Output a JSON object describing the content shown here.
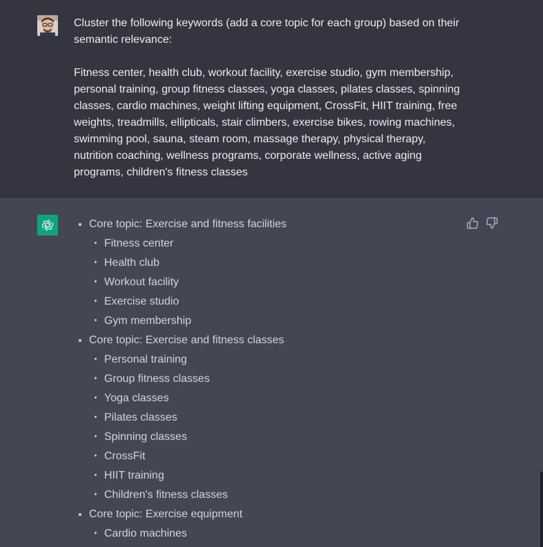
{
  "user_message": {
    "text": "Cluster the following keywords (add a core topic for each group) based on their semantic relevance:\n\nFitness center, health club, workout facility, exercise studio, gym membership, personal training, group fitness classes, yoga classes, pilates classes, spinning classes, cardio machines, weight lifting equipment, CrossFit, HIIT training, free weights, treadmills, ellipticals, stair climbers, exercise bikes, rowing machines, swimming pool, sauna, steam room, massage therapy, physical therapy, nutrition coaching, wellness programs, corporate wellness, active aging programs, children's fitness classes",
    "avatar": "user-avatar"
  },
  "assistant_message": {
    "avatar": "openai-logo-icon",
    "avatar_color": "#10a37f",
    "feedback": {
      "thumbs_up_icon": "thumbs-up-icon",
      "thumbs_down_icon": "thumbs-down-icon"
    },
    "topics": [
      {
        "label": "Core topic: Exercise and fitness facilities",
        "items": [
          "Fitness center",
          "Health club",
          "Workout facility",
          "Exercise studio",
          "Gym membership"
        ]
      },
      {
        "label": "Core topic: Exercise and fitness classes",
        "items": [
          "Personal training",
          "Group fitness classes",
          "Yoga classes",
          "Pilates classes",
          "Spinning classes",
          "CrossFit",
          "HIIT training",
          "Children's fitness classes"
        ]
      },
      {
        "label": "Core topic: Exercise equipment",
        "items": [
          "Cardio machines"
        ]
      }
    ]
  },
  "colors": {
    "user_bg": "#343541",
    "assistant_bg": "#444654",
    "text": "#ececf1",
    "assistant_text": "#d1d5db"
  }
}
